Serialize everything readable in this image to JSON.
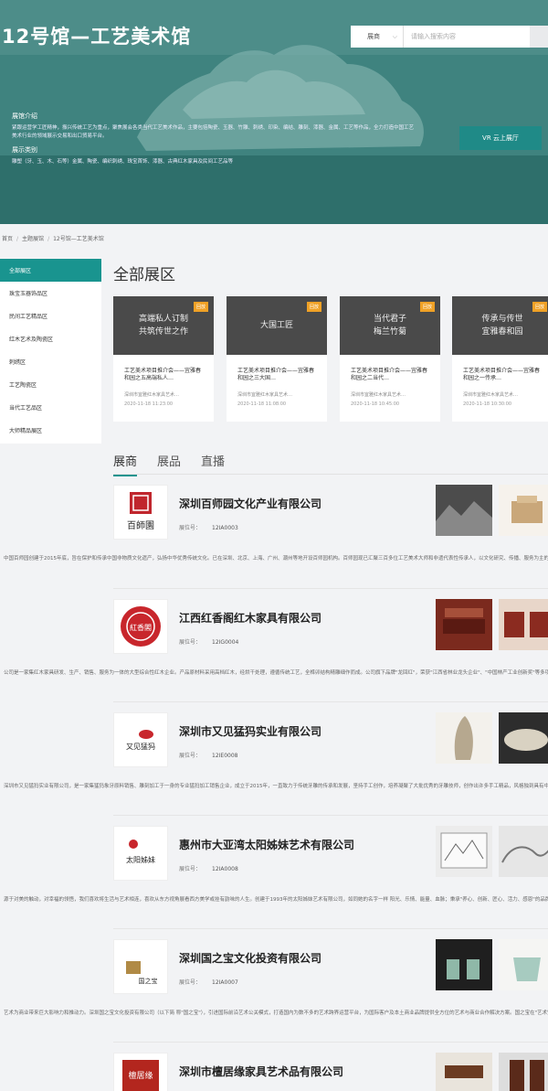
{
  "hero": {
    "title": "12号馆—工艺美术馆",
    "search": {
      "select": "展商",
      "placeholder": "请输入搜索内容"
    },
    "intro_heading": "展馆介绍",
    "intro_text": "紧跟运营学工匠精神，振兴传统工艺为重点，聚焦展会各类当代工艺美术作品，主要包括陶瓷、玉器、竹雕、刺绣、印染、编结、雕刻、漆器、金属、工艺等作品，全力打造中国工艺美术行业的领域展示交易和出口贸易平台。",
    "category_heading": "展示类别",
    "category_text": "雕塑（牙、玉、木、石等）金属、陶瓷、编织刺绣、珠宝首饰、漆器、古典红木家具及民间工艺品等",
    "vr_button": "VR 云上展厅"
  },
  "breadcrumb": [
    "首页",
    "主题展馆",
    "12号馆—工艺美术馆"
  ],
  "sidebar": {
    "items": [
      "全部展区",
      "珠宝玉器饰品区",
      "民间工艺精品区",
      "红木艺术及陶瓷区",
      "刺绣区",
      "工艺陶瓷区",
      "当代工艺品区",
      "大师精品展区"
    ]
  },
  "section_title": "全部展区",
  "cards": [
    {
      "img_text": "高端私人订制|共筑传世之作",
      "badge": "回放",
      "title": "工艺美术项目推介会——宜雅春和园之五高端私人…",
      "desc": "深圳市宜雅红木家具艺术…",
      "date": "2020-11-18 11:23:00"
    },
    {
      "img_text": "大国工匠",
      "badge": "回放",
      "title": "工艺美术项目推介会——宜雅春和园之三大国…",
      "desc": "深圳市宜雅红木家具艺术…",
      "date": "2020-11-18 11:08:00"
    },
    {
      "img_text": "当代君子|梅兰竹菊",
      "badge": "回放",
      "title": "工艺美术项目推介会——宜雅春和园之二当代…",
      "desc": "深圳市宜雅红木家具艺术…",
      "date": "2020-11-18 10:45:00"
    },
    {
      "img_text": "传承与传世|宜雅春和园",
      "badge": "回放",
      "title": "工艺美术项目推介会——宜雅春和园之一传承…",
      "desc": "深圳市宜雅红木家具艺术…",
      "date": "2020-11-18 10:30:00"
    }
  ],
  "tabs": [
    "展商",
    "展品",
    "直播"
  ],
  "exhibitors": [
    {
      "name": "深圳百师园文化产业有限公司",
      "booth_label": "展位号：",
      "booth": "12IA0003",
      "logo": "百師園",
      "desc": "中国百师园创建于2015年底，旨在保护和传承中国非物质文化遗产，弘扬中华优秀传统文化。已在深圳、北京、上海、广州、潮州等地开设百师园机构。百师园现已汇聚三百多位工艺美术大师和非遗代表性传承人，以文化研究、传播、服务为主的综合型文化产业平台。"
    },
    {
      "name": "江西红香阁红木家具有限公司",
      "booth_label": "展位号：",
      "booth": "12IG0004",
      "logo": "紅香閣",
      "desc": "公司是一家集红木家具研发、生产、销售、服务为一体的大型综合性红木企业。产品原材料采用高档红木，经烘干处理，遵循传统工艺，全榫卯结构精雕细作而成。公司旗下品牌\"龙回红\"，荣获\"江西省林业龙头企业\"、\"中国林产工业创新奖\"等多项荣誉,千年等一木。"
    },
    {
      "name": "深圳市又见猛犸实业有限公司",
      "booth_label": "展位号：",
      "booth": "12IE0008",
      "logo": "又见猛犸",
      "desc": "深圳市又见猛犸实业有限公司，是一家集猛犸象牙原料销售、雕刻加工于一身的专业猛犸加工销售企业，成立于2015年，一直致力于传统牙雕的传承和发展，坚持手工创作，培养凝聚了大批优秀的牙雕技师，创作出许多手工精品，风格独到具有中国传统文化特色的猛犸牙雕。"
    },
    {
      "name": "惠州市大亚湾太阳姊妹艺术有限公司",
      "booth_label": "展位号：",
      "booth": "12IA0008",
      "logo": "太阳姊妹",
      "desc": "源于对美的触动，对幸福的领悟，我们喜欢将生活与艺术相连，喜欢从东方视角展看西方美学或挂有韵味的人生。创建于1993年的太阳姊妹艺术有限公司，如同她的名字一样 阳光、乐情、能量、血脉；秉承\"养心、创新、匠心、活力、感恩\"的品牌核心理念；在墙面艺术领域不断前行。"
    },
    {
      "name": "深圳国之宝文化投资有限公司",
      "booth_label": "展位号：",
      "booth": "12IA0007",
      "logo": "国之宝",
      "desc": "艺术为商业带来巨大影响力和推动力。深圳国之宝文化投资有限公司（以下简 称\"国之宝\"），引进国际前沿艺术公关模式，打造国内为数不多的艺术跨界运营平台，为国际客户及本土商业品牌提供全方位的艺术与商业合作解决方案。国之宝在\"艺术空间、艺术活动、设计\"。"
    },
    {
      "name": "深圳市檀居缘家具艺术品有限公司",
      "booth_label": "展位号：",
      "booth": "",
      "logo": "檀居缘",
      "desc": ""
    }
  ]
}
